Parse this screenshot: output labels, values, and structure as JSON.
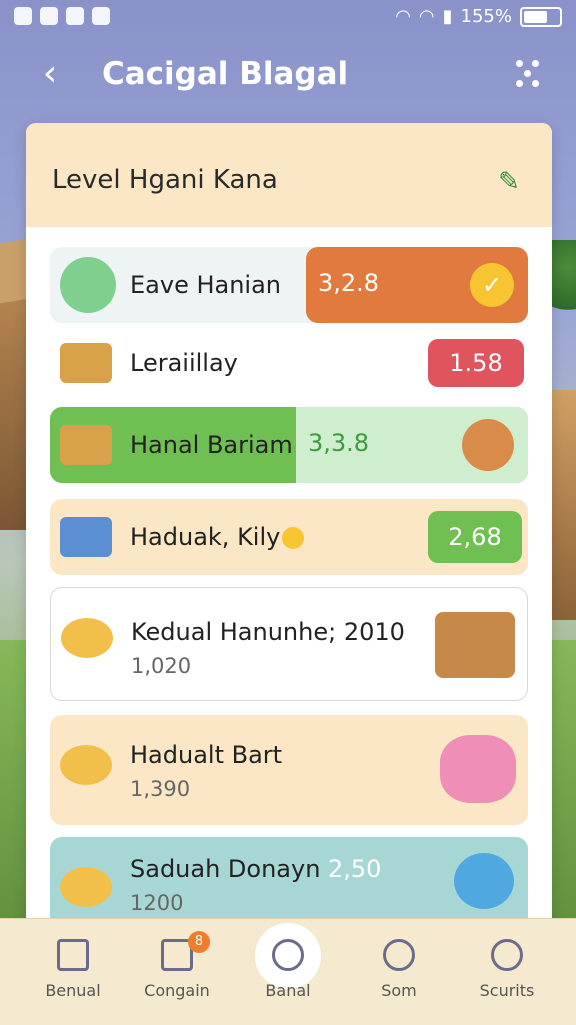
{
  "status_bar": {
    "battery_text": "155%"
  },
  "header": {
    "title": "Cacigal Blagal"
  },
  "card": {
    "title": "Level Hgani Kana"
  },
  "rows": [
    {
      "name": "Eave Hanian",
      "value": "3,2.8"
    },
    {
      "name": "Leraiillay",
      "value": "1.58"
    },
    {
      "name": "Hanal Bariam",
      "value": "3,3.8"
    },
    {
      "name": "Haduak, Kily",
      "value": "2,68"
    },
    {
      "name": "Kedual Hanunhe; 2010",
      "sub": "1,020"
    },
    {
      "name": "Hadualt Bart",
      "sub": "1,390"
    },
    {
      "name": "Saduah Donayn",
      "value": "2,50",
      "sub": "1200"
    }
  ],
  "tabs": [
    {
      "label": "Benual",
      "icon": "home-icon"
    },
    {
      "label": "Congain",
      "icon": "document-icon",
      "badge": "8"
    },
    {
      "label": "Banal",
      "icon": "search-icon"
    },
    {
      "label": "Som",
      "icon": "profile-icon"
    },
    {
      "label": "Scurits",
      "icon": "search-icon"
    }
  ],
  "colors": {
    "orange": "#e07a3e",
    "red": "#e0545e",
    "green": "#6fbf52",
    "mint": "#cfeed0",
    "peach": "#fbe7c6",
    "teal": "#a7d7d4"
  }
}
